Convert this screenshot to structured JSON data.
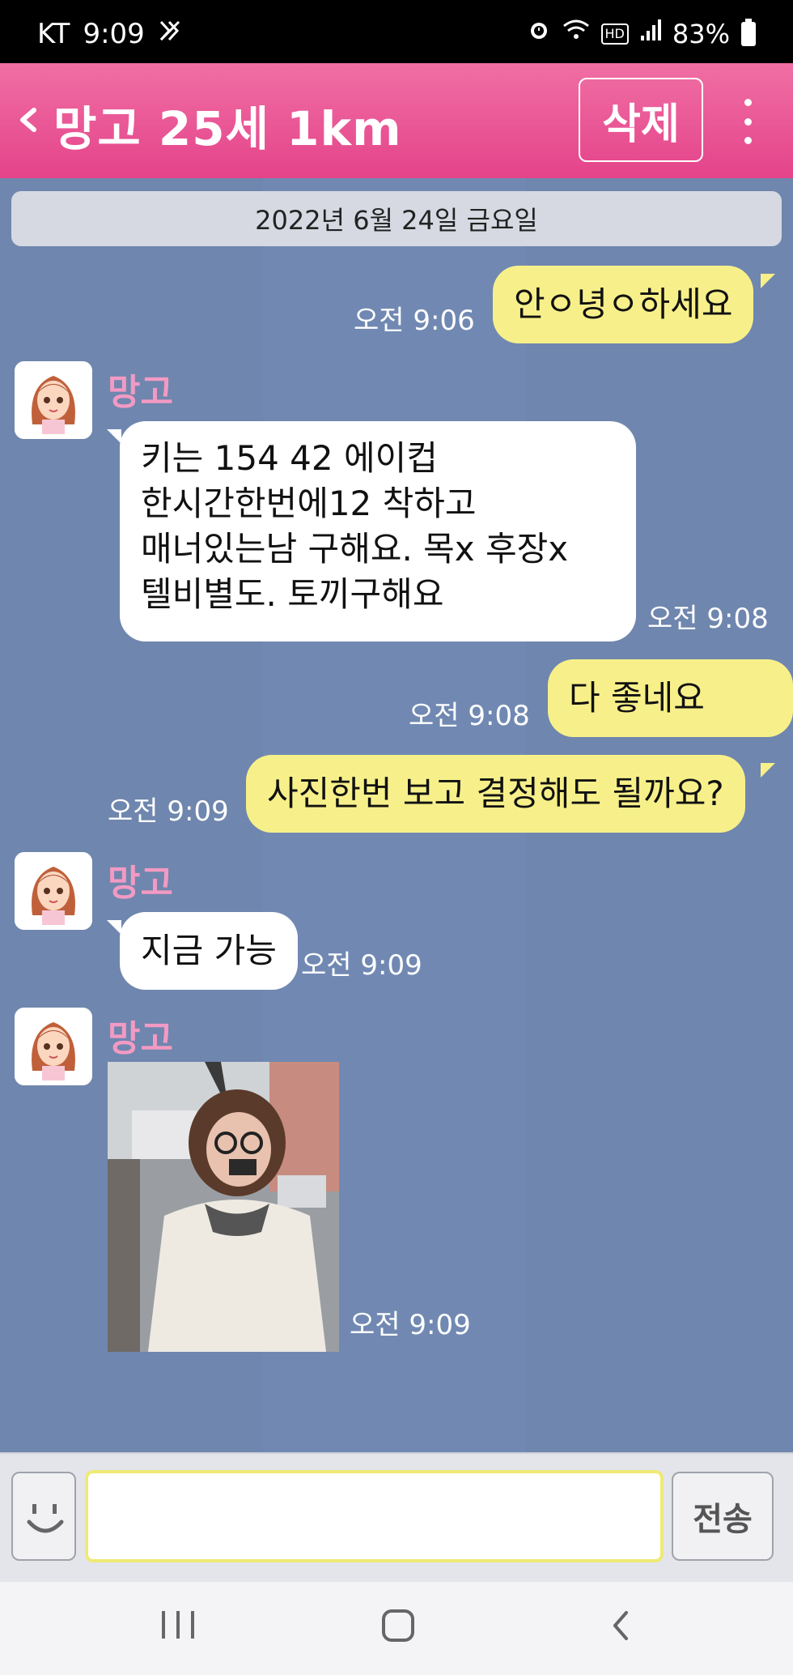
{
  "status": {
    "carrier": "KT",
    "time": "9:09",
    "battery": "83%",
    "icons": [
      "mute-vibrate-icon",
      "alarm-icon",
      "wifi-icon",
      "hd-icon",
      "signal-icon",
      "battery-icon"
    ]
  },
  "header": {
    "title": "망고 25세 1km",
    "delete_label": "삭제"
  },
  "chat": {
    "date_divider": "2022년 6월 24일 금요일",
    "messages": [
      {
        "from": "me",
        "text": "안ㅇ녕ㅇ하세요",
        "time": "오전 9:06"
      },
      {
        "from": "them",
        "sender": "망고",
        "lines": [
          "키는 154 42  에이컵",
          "한시간한번에12  착하고",
          "매너있는남 구해요. 목x 후장x",
          "텔비별도. 토끼구해요"
        ],
        "time": "오전 9:08"
      },
      {
        "from": "me",
        "text": "다 좋네요 ^^",
        "time": "오전 9:08"
      },
      {
        "from": "me",
        "text": "사진한번 보고 결정해도 될까요?",
        "time": "오전 9:09"
      },
      {
        "from": "them",
        "sender": "망고",
        "text": "지금 가능",
        "time": "오전 9:09"
      },
      {
        "from": "them",
        "sender": "망고",
        "type": "photo",
        "time": "오전 9:09"
      }
    ]
  },
  "input": {
    "value": "",
    "placeholder": "",
    "send_label": "전송"
  },
  "colors": {
    "header": "#e4438a",
    "chat_bg": "#6f86ae",
    "my_bubble": "#f7f08a",
    "their_bubble": "#ffffff",
    "sender_name": "#f29ac3"
  }
}
